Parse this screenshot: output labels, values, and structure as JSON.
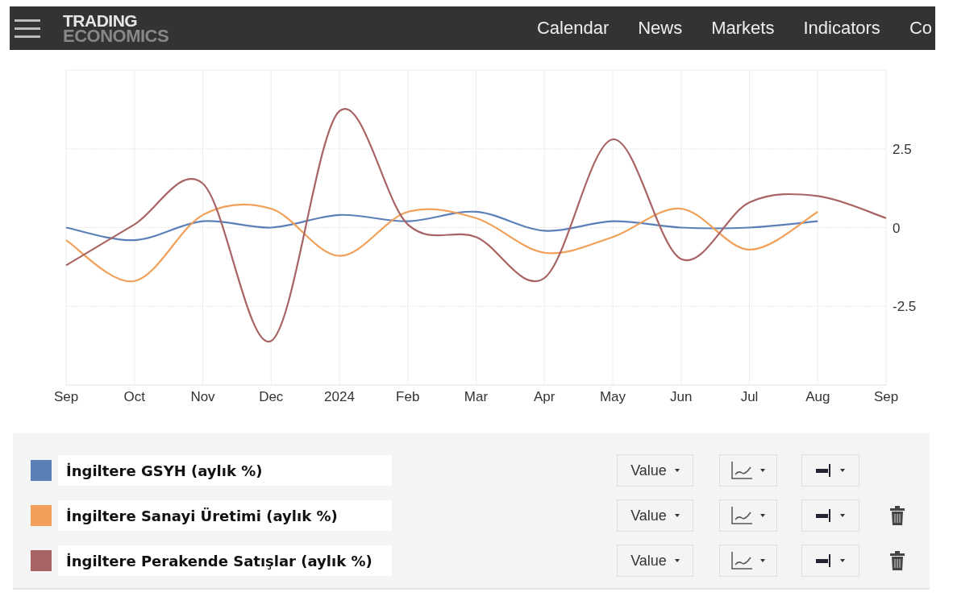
{
  "navbar": {
    "logo_top": "TRADING",
    "logo_bottom": "ECONOMICS",
    "links": [
      "Calendar",
      "News",
      "Markets",
      "Indicators",
      "Co"
    ]
  },
  "chart": {
    "chart_data": {
      "type": "line",
      "grid": true,
      "categories": [
        "Sep",
        "Oct",
        "Nov",
        "Dec",
        "2024",
        "Feb",
        "Mar",
        "Apr",
        "May",
        "Jun",
        "Jul",
        "Aug",
        "Sep"
      ],
      "ylim": [
        -5,
        5
      ],
      "yticks": [
        2.5,
        0,
        -2.5
      ],
      "series": [
        {
          "name": "İngiltere GSYH (aylık %)",
          "color": "#5b80b8",
          "values": [
            0,
            -0.4,
            0.2,
            0,
            0.4,
            0.2,
            0.5,
            -0.1,
            0.2,
            0,
            0,
            0.2,
            null
          ]
        },
        {
          "name": "İngiltere Sanayi Üretimi (aylık %)",
          "color": "#f0a058",
          "values": [
            -0.4,
            -1.7,
            0.4,
            0.6,
            -0.9,
            0.5,
            0.3,
            -0.8,
            -0.3,
            0.6,
            -0.7,
            0.5,
            null
          ]
        },
        {
          "name": "İngiltere Perakende Satışlar (aylık %)",
          "color": "#a86464",
          "values": [
            -1.2,
            0.1,
            1.4,
            -3.6,
            3.7,
            0.1,
            -0.3,
            -1.6,
            2.8,
            -1.0,
            0.8,
            1.0,
            0.3
          ]
        }
      ]
    }
  },
  "legend": [
    {
      "mode": "Value",
      "removable": false
    },
    {
      "mode": "Value",
      "removable": true
    },
    {
      "mode": "Value",
      "removable": true
    }
  ]
}
